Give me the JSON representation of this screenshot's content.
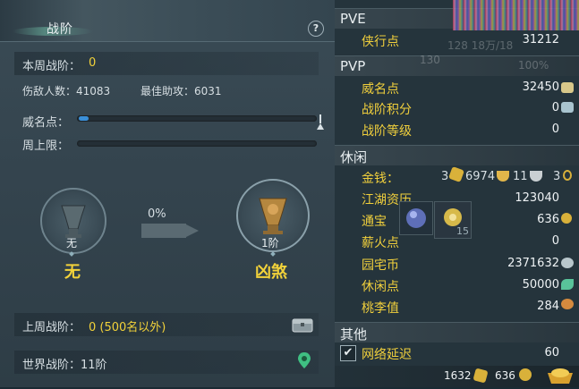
{
  "left": {
    "title": "战阶",
    "help_label": "?",
    "weekly_rank_label": "本周战阶：",
    "weekly_rank_value": "0",
    "kills_label": "伤敌人数：41083",
    "best_assist_label": "最佳助攻：6031",
    "fame_label": "威名点：",
    "fame_progress": 0.04,
    "weekly_cap_label": "周上限：",
    "weekly_cap_progress": 0,
    "progress_percent": "0%",
    "current_rank_tier": "无",
    "current_rank_name": "无",
    "next_rank_tier": "1阶",
    "next_rank_name": "凶煞",
    "last_week_label": "上周战阶：",
    "last_week_value": "0 (500名以外)",
    "world_rank_label": "世界战阶：11阶"
  },
  "right": {
    "pve_header": "PVE",
    "xiaxing_label": "侠行点",
    "xiaxing_value": "31212",
    "pvp_header": "PVP",
    "weiming_label": "威名点",
    "weiming_value": "32450",
    "zhanjie_score_label": "战阶积分",
    "zhanjie_score_value": "0",
    "zhanjie_level_label": "战阶等级",
    "zhanjie_level_value": "0",
    "leisure_header": "休闲",
    "money_label": "金钱：",
    "money_gold": "3",
    "money_silver": "6974",
    "money_copper": "11",
    "money_other": "3",
    "jianghu_label": "江湖资历",
    "jianghu_value": "123040",
    "tongbao_label": "通宝",
    "tongbao_value": "636",
    "tongbao_item_count": "15",
    "xinhuo_label": "薪火点",
    "xinhuo_value": "0",
    "yuanzhai_label": "园宅币",
    "yuanzhai_value": "2371632",
    "xiuxian_label": "休闲点",
    "xiuxian_value": "50000",
    "taoli_label": "桃李值",
    "taoli_value": "284",
    "other_header": "其他",
    "latency_label": "网络延迟",
    "latency_value": "60",
    "latency_checked": "✔",
    "footer_value_1": "1632",
    "footer_value_2": "636"
  },
  "bg_text": {
    "hp_text": "128 18万/18",
    "level_130": "130",
    "percent_100": "100%"
  },
  "colors": {
    "accent_yellow": "#f2d23a",
    "progress_blue": "#3a8fd8"
  }
}
